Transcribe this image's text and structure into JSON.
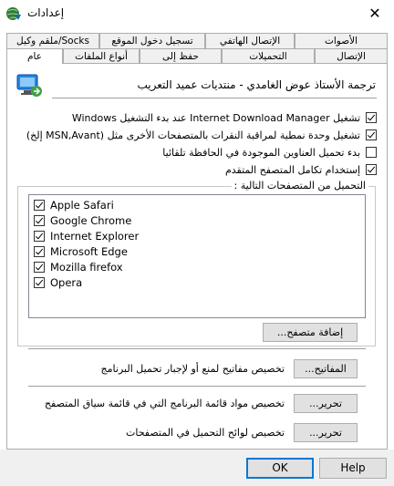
{
  "window": {
    "title": "إعدادات",
    "close_glyph": "✕"
  },
  "tabs_back": [
    {
      "label": "الأصوات"
    },
    {
      "label": "الإتصال الهاتفي"
    },
    {
      "label": "تسجيل دخول الموقع"
    },
    {
      "label": "Socks/ملقم وكيل"
    }
  ],
  "tabs_front": [
    {
      "label": "الإتصال"
    },
    {
      "label": "التحميلات"
    },
    {
      "label": "حفظ إلى"
    },
    {
      "label": "أنواع الملفات"
    },
    {
      "label": "عام"
    }
  ],
  "header": {
    "title": "ترجمة الأستاذ عوض الغامدي - منتديات عميد التعريب"
  },
  "options": [
    {
      "label": "تشغيل Internet Download Manager عند بدء التشغيل Windows",
      "checked": true
    },
    {
      "label": "تشغيل وحدة نمطية لمراقبة النقرات بالمتصفحات الأخرى مثل (MSN,Avant إلخ)",
      "checked": true
    },
    {
      "label": "بدء تحميل العناوين الموجودة في الحافظة تلقائيا",
      "checked": false
    },
    {
      "label": "إستخدام تكامل المتصفح المتقدم",
      "checked": true
    }
  ],
  "browsers_group": {
    "label": "التحميل من المتصفحات التالية :",
    "items": [
      {
        "label": "Apple Safari",
        "checked": true
      },
      {
        "label": "Google Chrome",
        "checked": true
      },
      {
        "label": "Internet Explorer",
        "checked": true
      },
      {
        "label": "Microsoft Edge",
        "checked": true
      },
      {
        "label": "Mozilla firefox",
        "checked": true
      },
      {
        "label": "Opera",
        "checked": true
      }
    ],
    "add_button": "إضافة متصفح..."
  },
  "keys": {
    "button": "المفاتيح...",
    "description": "تخصيص مفاتيح لمنع أو لإجبار تحميل البرنامج"
  },
  "context_menu": {
    "button": "تحرير...",
    "description": "تخصيص مواد قائمة البرنامج التي في قائمة سياق المتصفح"
  },
  "download_panels": {
    "button": "تحرير...",
    "description": "تخصيص لوائح التحميل في المتصفحات"
  },
  "footer": {
    "ok": "OK",
    "help": "Help"
  },
  "colors": {
    "accent": "#0078d7",
    "panel_border": "#adadad",
    "footer_bg": "#f0f0f0"
  }
}
